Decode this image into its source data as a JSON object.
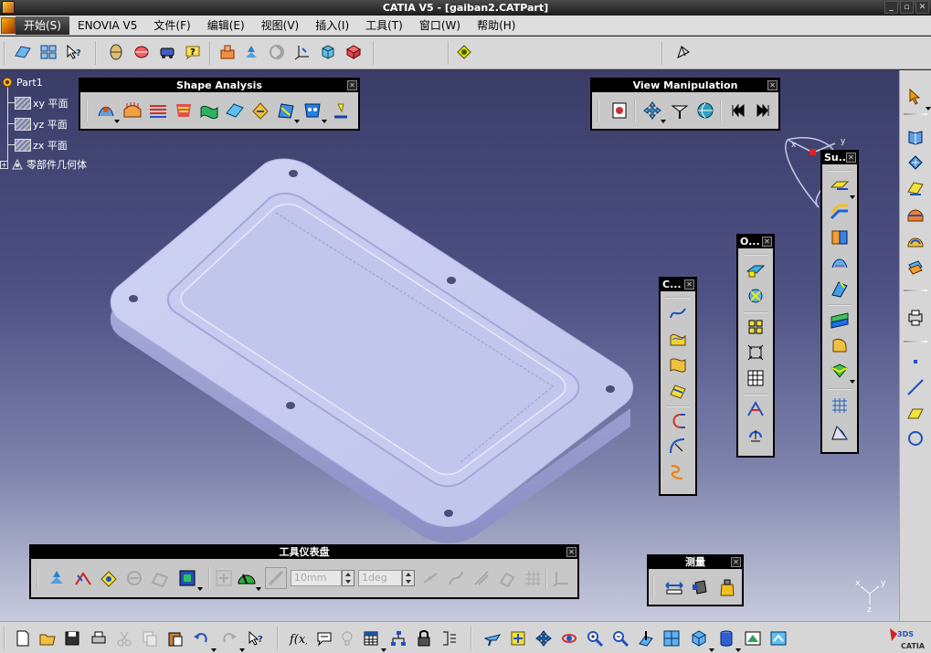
{
  "window": {
    "title": "CATIA V5 - [gaiban2.CATPart]"
  },
  "menu": {
    "items": [
      {
        "label": "开始(S)"
      },
      {
        "label": "ENOVIA V5"
      },
      {
        "label": "文件(F)"
      },
      {
        "label": "编辑(E)"
      },
      {
        "label": "视图(V)"
      },
      {
        "label": "插入(I)"
      },
      {
        "label": "工具(T)"
      },
      {
        "label": "窗口(W)"
      },
      {
        "label": "帮助(H)"
      }
    ]
  },
  "tree": {
    "root": "Part1",
    "items": [
      {
        "label": "xy 平面"
      },
      {
        "label": "yz 平面"
      },
      {
        "label": "zx 平面"
      },
      {
        "label": "零部件几何体"
      }
    ]
  },
  "toolbars": {
    "shape_analysis": "Shape Analysis",
    "view_manipulation": "View Manipulation",
    "surfaces": "Su...",
    "operations": "O...",
    "curves": "C...",
    "dashboard": "工具仪表盘",
    "measure": "测量"
  },
  "dashboard": {
    "distance_value": "10mm",
    "angle_value": "1deg"
  },
  "compass": {
    "x_label": "x",
    "y_label": "y",
    "z_label": "z"
  },
  "brand": {
    "logo_text": "CATIA",
    "logo_mark": "3DS"
  },
  "colors": {
    "viewport_top": "#3b3d68",
    "viewport_bottom": "#c8cbdc",
    "part_face": "#c5c8ee",
    "part_side": "#9da1d2",
    "accent": "#f0a000"
  }
}
